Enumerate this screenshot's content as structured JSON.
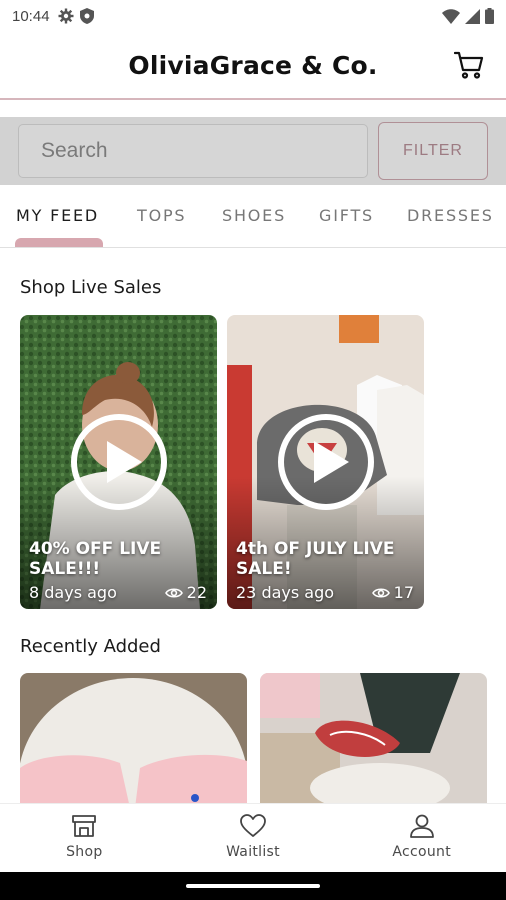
{
  "status_bar": {
    "time": "10:44",
    "left_icons": [
      "gear-icon",
      "shield-icon"
    ],
    "right_icons": [
      "wifi-icon",
      "signal-icon",
      "battery-icon"
    ]
  },
  "header": {
    "title": "OliviaGrace & Co.",
    "cart_icon": "cart-icon"
  },
  "search": {
    "placeholder": "Search",
    "filter_label": "FILTER"
  },
  "tabs": [
    {
      "label": "MY FEED",
      "active": true
    },
    {
      "label": "TOPS",
      "active": false
    },
    {
      "label": "SHOES",
      "active": false
    },
    {
      "label": "GIFTS",
      "active": false
    },
    {
      "label": "DRESSES",
      "active": false
    }
  ],
  "live_sales": {
    "title": "Shop Live Sales",
    "items": [
      {
        "title": "40% OFF LIVE SALE!!!",
        "time": "8 days ago",
        "views": "22"
      },
      {
        "title": "4th OF JULY LIVE SALE!",
        "time": "23 days ago",
        "views": "17"
      }
    ]
  },
  "recently_added": {
    "title": "Recently Added"
  },
  "bottom_nav": [
    {
      "label": "Shop",
      "icon": "shop-icon"
    },
    {
      "label": "Waitlist",
      "icon": "heart-icon"
    },
    {
      "label": "Account",
      "icon": "person-icon"
    }
  ],
  "colors": {
    "accent": "#d7a7af",
    "filter_text": "#9d7b82",
    "search_bg": "#d2d2d2"
  }
}
